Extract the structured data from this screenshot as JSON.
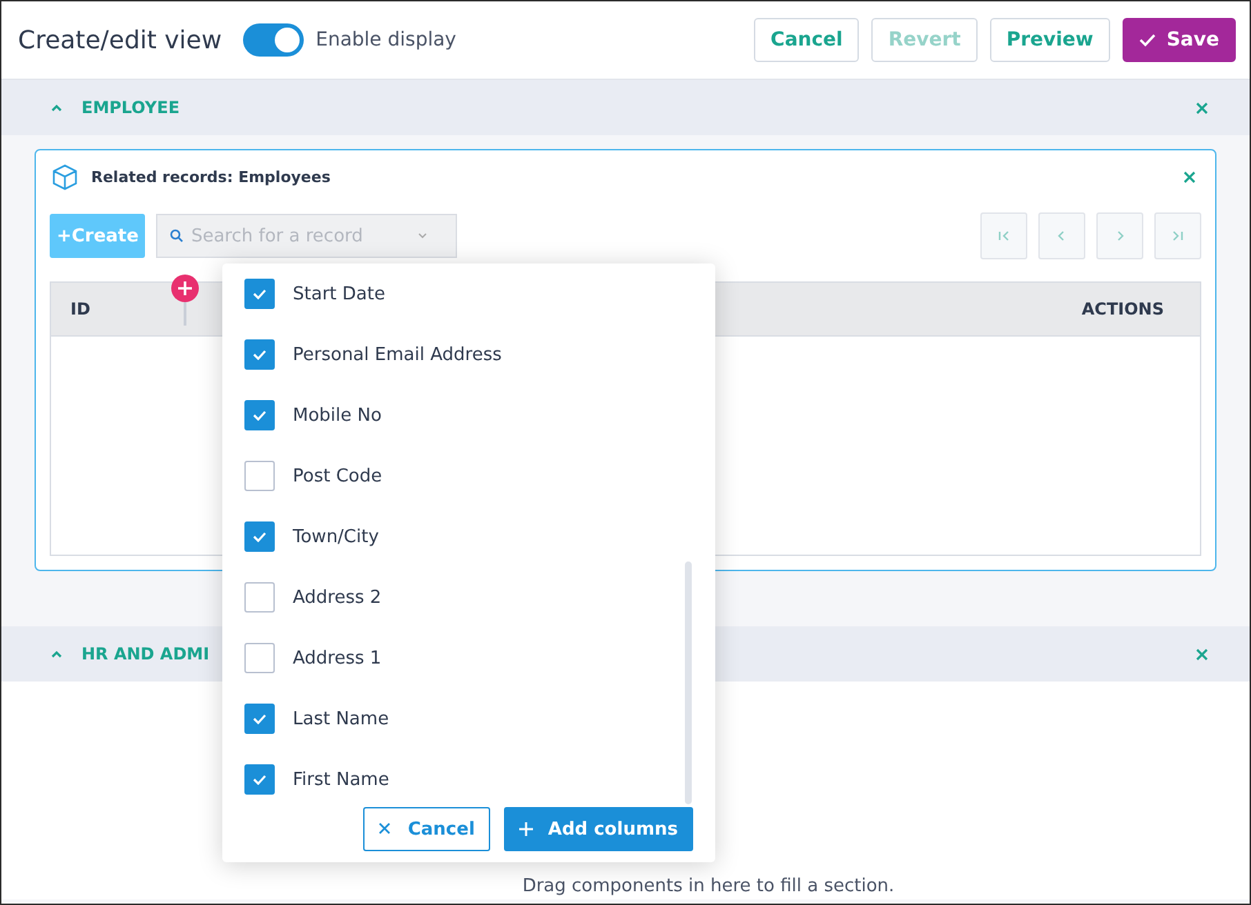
{
  "header": {
    "title": "Create/edit view",
    "toggle": {
      "label": "Enable display",
      "on": true
    },
    "buttons": [
      {
        "label": "Cancel",
        "kind": "outline",
        "disabled": false
      },
      {
        "label": "Revert",
        "kind": "outline",
        "disabled": true
      },
      {
        "label": "Preview",
        "kind": "outline",
        "disabled": false
      },
      {
        "label": "Save",
        "kind": "primary",
        "disabled": false
      }
    ]
  },
  "sections": [
    {
      "title": "EMPLOYEE",
      "expanded": true,
      "card": {
        "title": "Related records: Employees",
        "create_button": "+Create",
        "search": {
          "placeholder": "Search for a record"
        },
        "columns": [
          "ID",
          "ACTIONS"
        ]
      }
    },
    {
      "title": "HR AND ADMI",
      "expanded": true,
      "hint": "Drag components in here to fill a section."
    }
  ],
  "column_picker": {
    "items": [
      {
        "label": "Start Date",
        "checked": true
      },
      {
        "label": "Personal Email Address",
        "checked": true
      },
      {
        "label": "Mobile No",
        "checked": true
      },
      {
        "label": "Post Code",
        "checked": false
      },
      {
        "label": "Town/City",
        "checked": true
      },
      {
        "label": "Address 2",
        "checked": false
      },
      {
        "label": "Address 1",
        "checked": false
      },
      {
        "label": "Last Name",
        "checked": true
      },
      {
        "label": "First Name",
        "checked": true
      }
    ],
    "buttons": [
      {
        "label": "Cancel",
        "kind": "cancel"
      },
      {
        "label": "Add columns",
        "kind": "add"
      }
    ]
  }
}
